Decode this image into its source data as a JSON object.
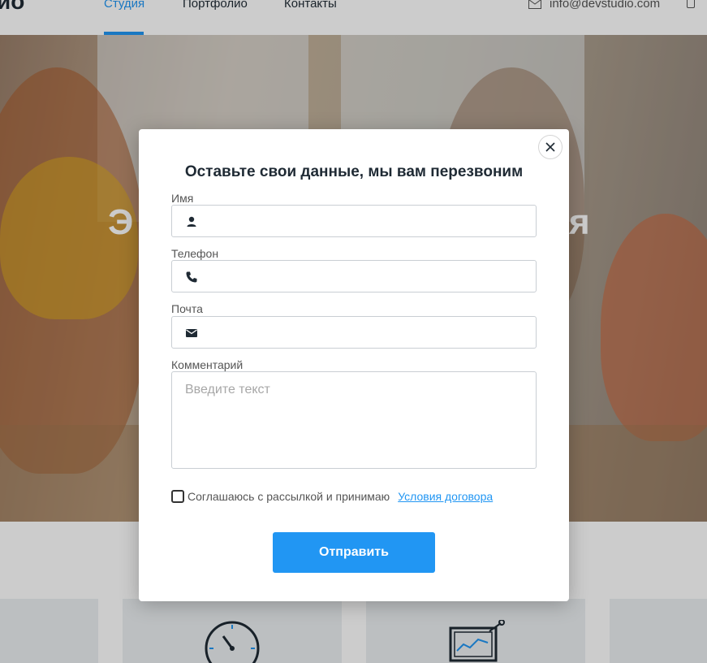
{
  "header": {
    "logo": "ио",
    "nav": [
      {
        "label": "Студия"
      },
      {
        "label": "Портфолио"
      },
      {
        "label": "Контакты"
      }
    ],
    "email": "info@devstudio.com"
  },
  "hero": {
    "title_left": "Э",
    "title_right": "ия"
  },
  "modal": {
    "title": "Оставьте свои данные, мы вам перезвоним",
    "fields": {
      "name": {
        "label": "Имя",
        "value": ""
      },
      "phone": {
        "label": "Телефон",
        "value": ""
      },
      "email": {
        "label": "Почта",
        "value": ""
      },
      "comment": {
        "label": "Комментарий",
        "placeholder": "Введите текст"
      }
    },
    "agree_text": "Соглашаюсь с рассылкой и принимаю",
    "agree_link": "Условия договора",
    "submit_label": "Отправить"
  },
  "colors": {
    "accent": "#2196f3",
    "text": "#1f2a34",
    "label": "#555555",
    "border": "#c9ced3"
  }
}
